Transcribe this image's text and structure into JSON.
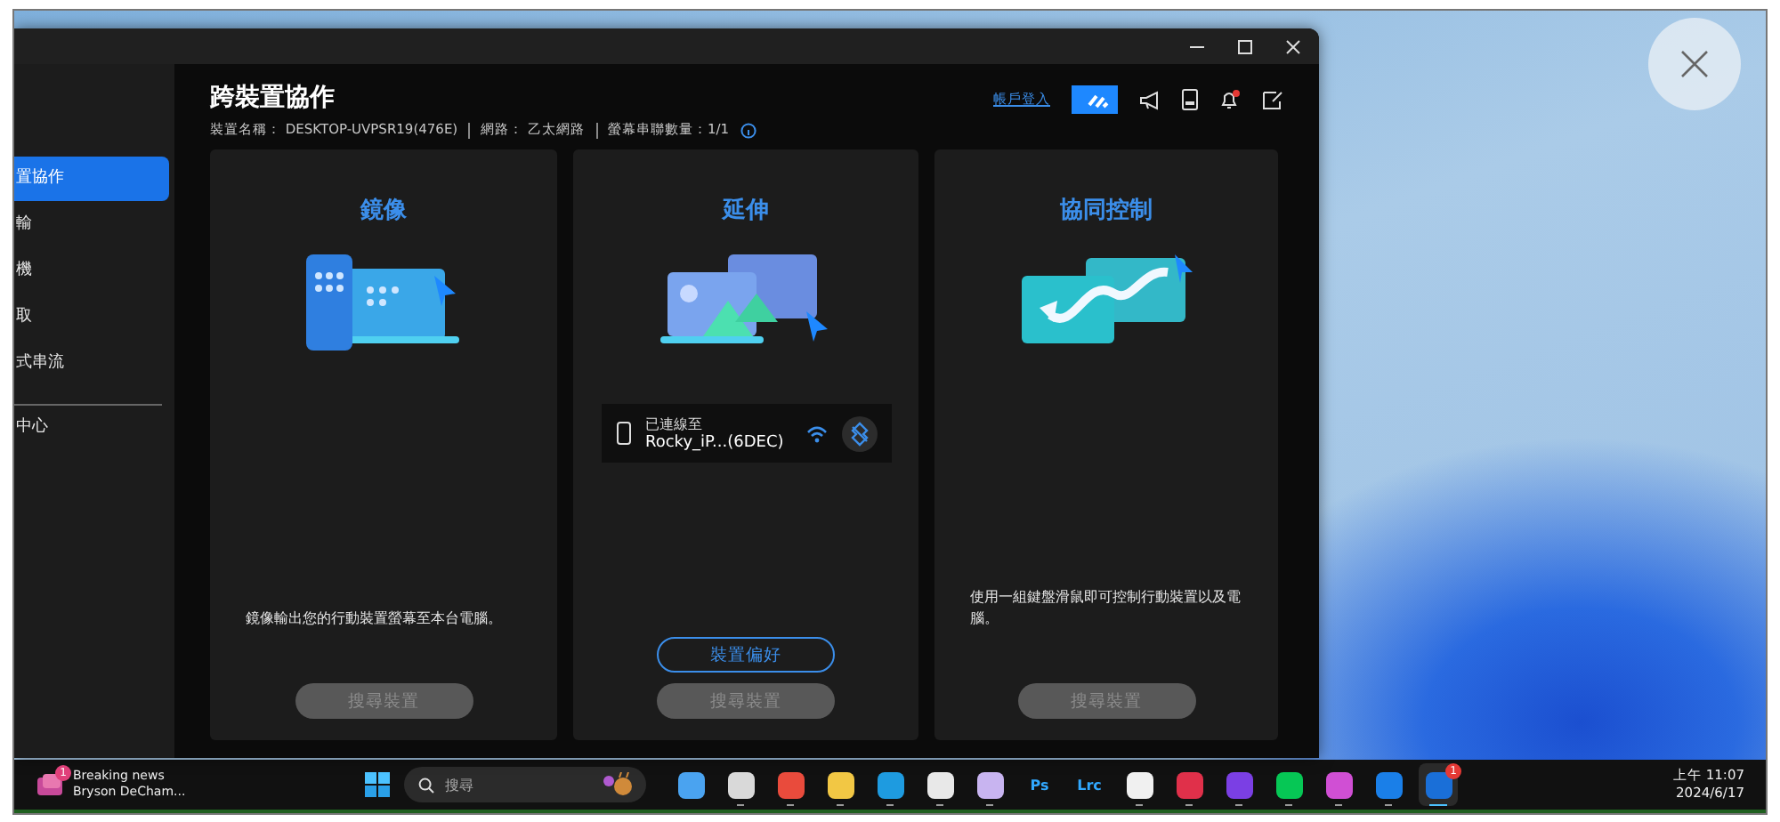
{
  "window": {
    "title": "跨裝置協作",
    "device_info": [
      {
        "label": "裝置名稱： DESKTOP-UVPSR19(476E)"
      },
      {
        "label": "網路： 乙太網路"
      },
      {
        "label": "螢幕串聯數量：1/1"
      }
    ],
    "account_link": "帳戶登入"
  },
  "sidebar": {
    "items": [
      {
        "label": "置協作",
        "selected": true,
        "divider_before": false
      },
      {
        "label": "輸",
        "selected": false,
        "divider_before": false
      },
      {
        "label": "機",
        "selected": false,
        "divider_before": false
      },
      {
        "label": "取",
        "selected": false,
        "divider_before": false
      },
      {
        "label": "式串流",
        "selected": false,
        "divider_before": false
      },
      {
        "label": "中心",
        "selected": false,
        "divider_before": true
      }
    ]
  },
  "cards": [
    {
      "kind": "mirror",
      "title": "鏡像",
      "description": "鏡像輸出您的行動裝置螢幕至本台電腦。",
      "button": {
        "label": "搜尋裝置",
        "disabled": true
      }
    },
    {
      "kind": "extend",
      "title": "延伸",
      "connection": {
        "status": "已連線至",
        "device": "Rocky_iP...(6DEC)"
      },
      "secondary_button": "裝置偏好",
      "button": {
        "label": "搜尋裝置",
        "disabled": true
      }
    },
    {
      "kind": "control",
      "title": "協同控制",
      "description": "使用一組鍵盤滑鼠即可控制行動裝置以及電腦。",
      "button": {
        "label": "搜尋裝置",
        "disabled": true
      }
    }
  ],
  "taskbar": {
    "news": {
      "title": "Breaking news",
      "subtitle": "Bryson DeCham...",
      "badge": "1"
    },
    "search": {
      "placeholder": "搜尋"
    },
    "apps": [
      {
        "kind": "tile",
        "color": "#4aa3f0",
        "running": false,
        "selected": false
      },
      {
        "kind": "tile",
        "color": "#d9d9d9",
        "running": true,
        "selected": false
      },
      {
        "kind": "tile",
        "color": "#e94b3c",
        "running": true,
        "selected": false
      },
      {
        "kind": "tile",
        "color": "#f2c744",
        "running": true,
        "selected": false
      },
      {
        "kind": "tile",
        "color": "#1e9be0",
        "running": true,
        "selected": false
      },
      {
        "kind": "tile",
        "color": "#e8e8e8",
        "running": true,
        "selected": false
      },
      {
        "kind": "tile",
        "color": "#c8b4f0",
        "running": true,
        "selected": false
      },
      {
        "kind": "text",
        "label": "Ps",
        "color": "#31a8ff",
        "running": false,
        "selected": false
      },
      {
        "kind": "text",
        "label": "Lrc",
        "color": "#31a8ff",
        "running": false,
        "selected": false
      },
      {
        "kind": "tile",
        "color": "#f0f0f0",
        "running": true,
        "selected": false
      },
      {
        "kind": "tile",
        "color": "#e0304a",
        "running": true,
        "selected": false
      },
      {
        "kind": "tile",
        "color": "#7b3fe4",
        "running": true,
        "selected": false
      },
      {
        "kind": "tile",
        "color": "#06c755",
        "running": true,
        "selected": false
      },
      {
        "kind": "tile",
        "color": "#d04fd4",
        "running": true,
        "selected": false
      },
      {
        "kind": "tile",
        "color": "#1a7fe8",
        "running": true,
        "selected": false
      },
      {
        "kind": "tile",
        "color": "#1a6fd8",
        "running": true,
        "selected": true,
        "badge": "1"
      }
    ],
    "clock": {
      "time": "上午 11:07",
      "date": "2024/6/17"
    }
  }
}
